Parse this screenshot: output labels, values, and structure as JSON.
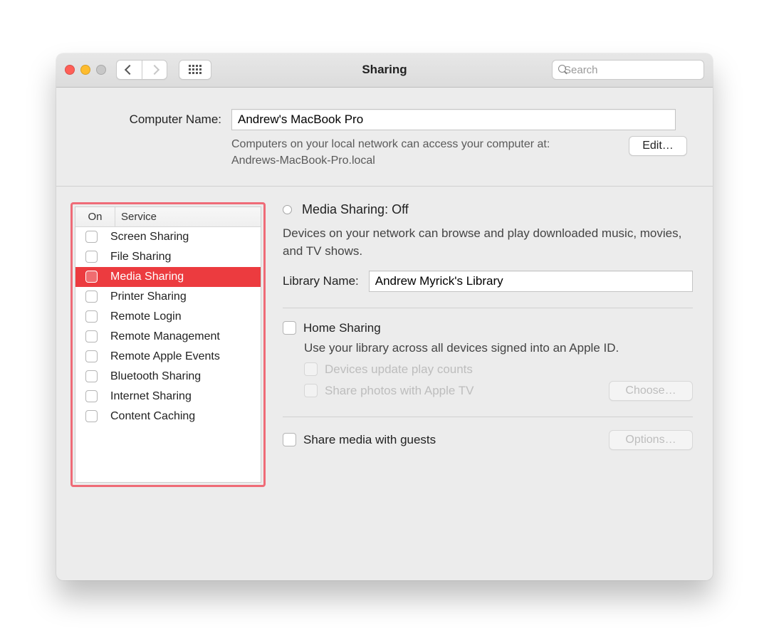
{
  "window": {
    "title": "Sharing"
  },
  "search": {
    "placeholder": "Search"
  },
  "computerName": {
    "label": "Computer Name:",
    "value": "Andrew's MacBook Pro",
    "helpLine1": "Computers on your local network can access your computer at:",
    "helpLine2": "Andrews-MacBook-Pro.local",
    "editButton": "Edit…"
  },
  "servicesHeader": {
    "on": "On",
    "service": "Service"
  },
  "services": [
    {
      "label": "Screen Sharing",
      "on": false,
      "selected": false
    },
    {
      "label": "File Sharing",
      "on": false,
      "selected": false
    },
    {
      "label": "Media Sharing",
      "on": false,
      "selected": true
    },
    {
      "label": "Printer Sharing",
      "on": false,
      "selected": false
    },
    {
      "label": "Remote Login",
      "on": false,
      "selected": false
    },
    {
      "label": "Remote Management",
      "on": false,
      "selected": false
    },
    {
      "label": "Remote Apple Events",
      "on": false,
      "selected": false
    },
    {
      "label": "Bluetooth Sharing",
      "on": false,
      "selected": false
    },
    {
      "label": "Internet Sharing",
      "on": false,
      "selected": false
    },
    {
      "label": "Content Caching",
      "on": false,
      "selected": false
    }
  ],
  "detail": {
    "title": "Media Sharing: Off",
    "description": "Devices on your network can browse and play downloaded music, movies, and TV shows.",
    "libraryLabel": "Library Name:",
    "libraryValue": "Andrew Myrick's Library",
    "homeSharing": {
      "label": "Home Sharing",
      "desc": "Use your library across all devices signed into an Apple ID.",
      "opt1": "Devices update play counts",
      "opt2": "Share photos with Apple TV",
      "chooseBtn": "Choose…"
    },
    "guests": {
      "label": "Share media with guests",
      "optionsBtn": "Options…"
    }
  },
  "help": "?"
}
